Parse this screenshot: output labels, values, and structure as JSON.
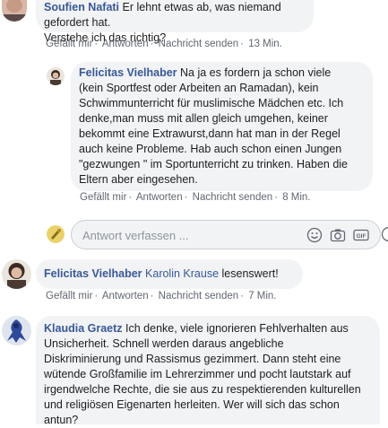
{
  "comments": [
    {
      "author": "Soufien Nafati",
      "text_lines": [
        "Er lehnt etwas ab, was niemand gefordert hat.",
        "Verstehe ich das richtig?"
      ],
      "actions": {
        "like": "Gefällt mir",
        "reply": "Antworten",
        "message": "Nachricht senden",
        "time": "13 Min."
      }
    },
    {
      "author": "Felicitas Vielhaber",
      "text_lines": [
        "Na ja es fordern ja schon viele",
        "(kein Sportfest oder Arbeiten an Ramadan), kein",
        "Schwimmunterricht für muslimische Mädchen etc. Ich",
        "denke,man muss mit allen gleich umgehen, keiner",
        "bekommt eine Extrawurst,dann hat man in der Regel",
        "auch keine Probleme. Hab auch schon einen Jungen",
        "\"gezwungen \" im Sportunterricht zu trinken. Haben die",
        "Eltern aber eingesehen."
      ],
      "actions": {
        "like": "Gefällt mir",
        "reply": "Antworten",
        "message": "Nachricht senden",
        "time": "8 Min."
      }
    },
    {
      "author": "Felicitas Vielhaber",
      "mention": "Karolin Krause",
      "text_lines": [
        "lesenswert!"
      ],
      "actions": {
        "like": "Gefällt mir",
        "reply": "Antworten",
        "message": "Nachricht senden",
        "time": "7 Min."
      }
    },
    {
      "author": "Klaudia Graetz",
      "text_lines": [
        "Ich denke, viele ignorieren Fehlverhalten aus",
        "Unsicherheit. Schnell werden daraus angebliche",
        "Diskriminierung und Rassismus gezimmert. Dann steht eine",
        "wütende Großfamilie im Lehrerzimmer und pocht lautstark auf",
        "irgendwelche Rechte, die sie aus zu respektierenden kulturellen",
        "und religiösen Eigenarten herleiten. Wer will sich das schon",
        "antun?"
      ]
    }
  ],
  "reply_input": {
    "placeholder": "Antwort verfassen ..."
  },
  "icons": [
    "emoji-icon",
    "camera-icon",
    "gif-icon",
    "sticker-icon"
  ],
  "colors": {
    "link": "#385898",
    "bubble": "#f2f3f5",
    "meta": "#606770"
  }
}
